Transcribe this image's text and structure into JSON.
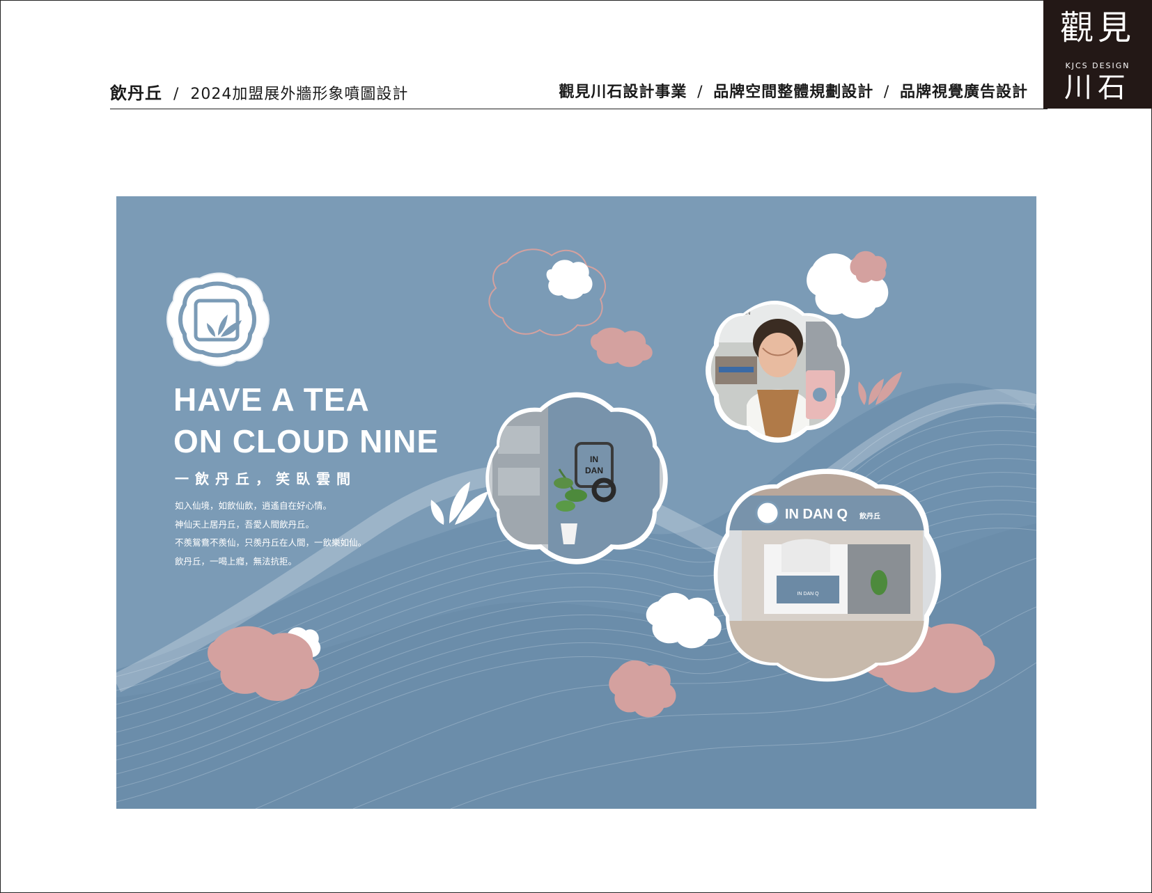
{
  "header": {
    "brand": "飲丹丘",
    "separator": "/",
    "project_title": "2024加盟展外牆形象噴圖設計",
    "company": "觀見川石設計事業",
    "service_1": "品牌空間整體規劃設計",
    "service_2": "品牌視覺廣告設計"
  },
  "logo": {
    "top_chars": "觀見",
    "subtitle": "KJCS DESIGN",
    "bottom_chars": "川石"
  },
  "poster": {
    "slogan_line1": "HAVE A TEA",
    "slogan_line2": "ON CLOUD NINE",
    "sub_slogan": "一飲丹丘，笑臥雲間",
    "poem": [
      "如入仙境，如飲仙飲，逍遙自在好心情。",
      "神仙天上居丹丘，吾愛人間飲丹丘。",
      "不羨鴛鴦不羨仙，只羨丹丘在人間，一飲樂如仙。",
      "飲丹丘，一喝上癮，無法抗拒。"
    ],
    "wall_sign": "IN DAN Q",
    "storefront_sign": "IN DAN Q",
    "storefront_sign_cn": "飲丹丘",
    "counter_text": "IN DAN Q",
    "colors": {
      "background": "#7b9bb6",
      "pink": "#d4a19f",
      "white": "#ffffff"
    }
  }
}
